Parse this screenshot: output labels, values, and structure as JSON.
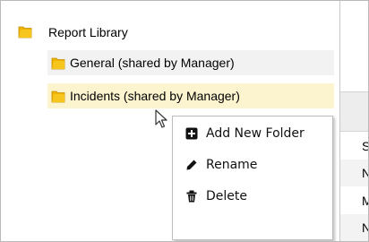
{
  "tree": {
    "root": {
      "label": "Report Library",
      "icon": "folder-icon"
    },
    "children": [
      {
        "label": "General (shared by Manager)",
        "icon": "folder-icon",
        "state": "hover"
      },
      {
        "label": "Incidents (shared by Manager)",
        "icon": "folder-icon",
        "state": "selected"
      }
    ]
  },
  "context_menu": {
    "items": [
      {
        "label": "Add New Folder",
        "icon": "plus-square-icon"
      },
      {
        "label": "Rename",
        "icon": "pencil-icon"
      },
      {
        "label": "Delete",
        "icon": "trash-icon"
      }
    ]
  },
  "right_panel": {
    "row_initials": [
      "S",
      "N",
      "M",
      "N"
    ]
  },
  "colors": {
    "folder": "#f0b400",
    "selected_bg": "#fcf4cf",
    "hover_bg": "#f2f2f2",
    "menu_border": "#bdbdbd"
  }
}
